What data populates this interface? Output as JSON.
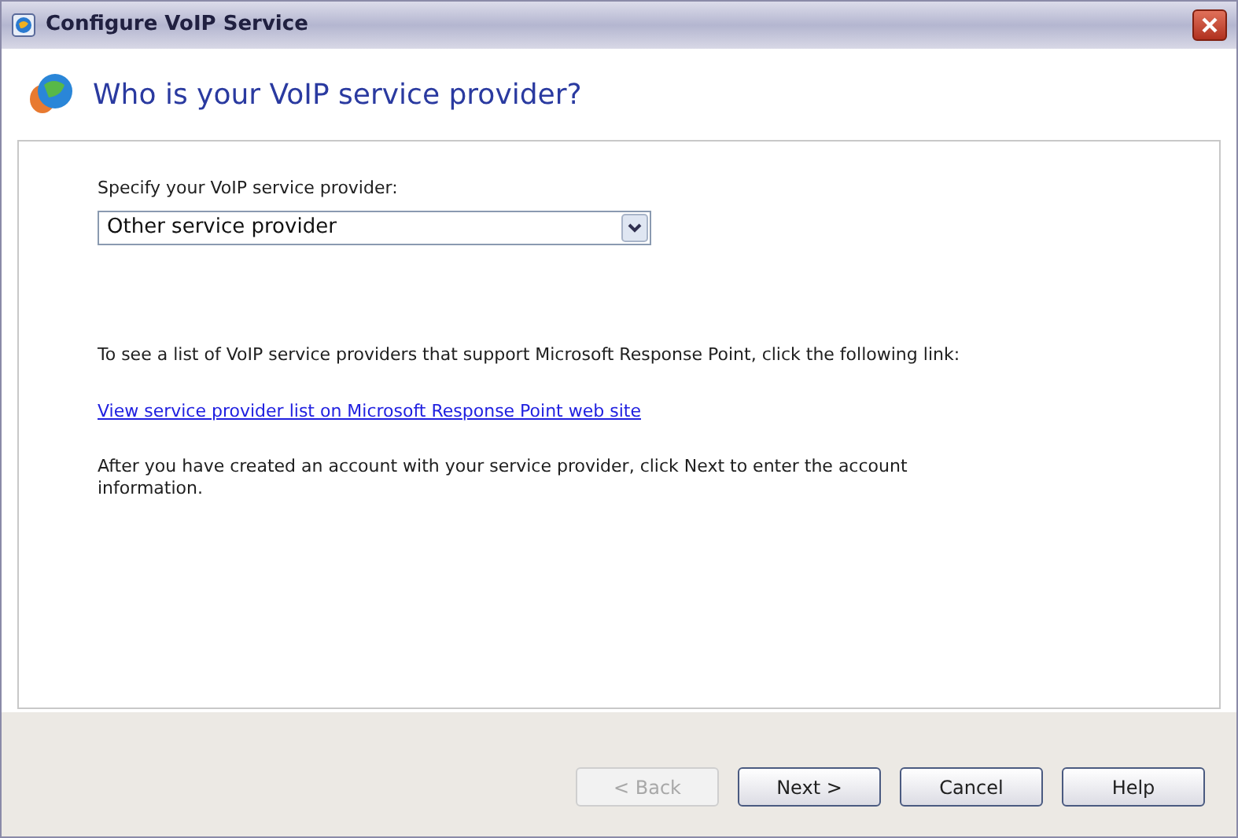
{
  "window": {
    "title": "Configure VoIP Service"
  },
  "header": {
    "title": "Who is your VoIP service provider?"
  },
  "provider_field": {
    "label": "Specify your VoIP service provider:",
    "value": "Other service provider"
  },
  "info_text": "To see a list of VoIP service providers that support Microsoft Response Point, click the following link:",
  "link": "View service provider list on Microsoft Response Point web site",
  "next_text": "After you have created an account with your service provider, click Next to enter the account information.",
  "buttons": [
    {
      "label": "< Back",
      "disabled": true
    },
    {
      "label": "Next >",
      "disabled": false
    },
    {
      "label": "Cancel",
      "disabled": false
    },
    {
      "label": "Help",
      "disabled": false
    }
  ]
}
